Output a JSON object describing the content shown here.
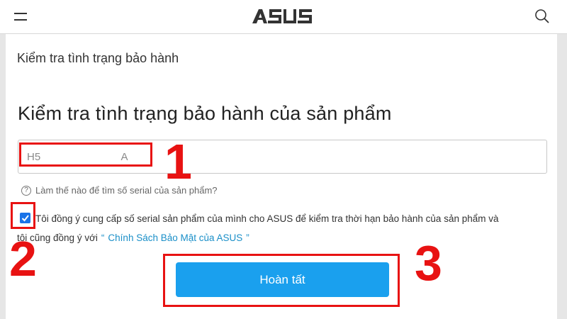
{
  "header": {
    "logo_text": "ASUS"
  },
  "breadcrumb": "Kiểm tra tình trạng bảo hành",
  "page_title": "Kiểm tra tình trạng bảo hành của sản phẩm",
  "serial": {
    "value": "H5 A"
  },
  "help_link": "Làm thế nào để tìm số serial của sản phẩm?",
  "consent": {
    "checked": true,
    "line1": "Tôi đồng ý cung cấp số serial sản phẩm của mình cho ASUS để kiểm tra thời hạn bảo hành của sản phẩm và",
    "line2": "tôi cũng đồng ý với",
    "open_quote": "“",
    "link": "Chính Sách Bảo Mật của ASUS",
    "close_quote": "”"
  },
  "button": {
    "label": "Hoàn tất"
  },
  "annotations": {
    "step1": "1",
    "step2": "2",
    "step3": "3"
  },
  "colors": {
    "accent": "#1aa0ee",
    "link": "#1a8fc8",
    "annotation": "#e81212",
    "checkbox": "#1a73e8"
  },
  "icons": [
    "menu-icon",
    "asus-logo",
    "search-icon",
    "help-icon",
    "checkmark-icon"
  ]
}
